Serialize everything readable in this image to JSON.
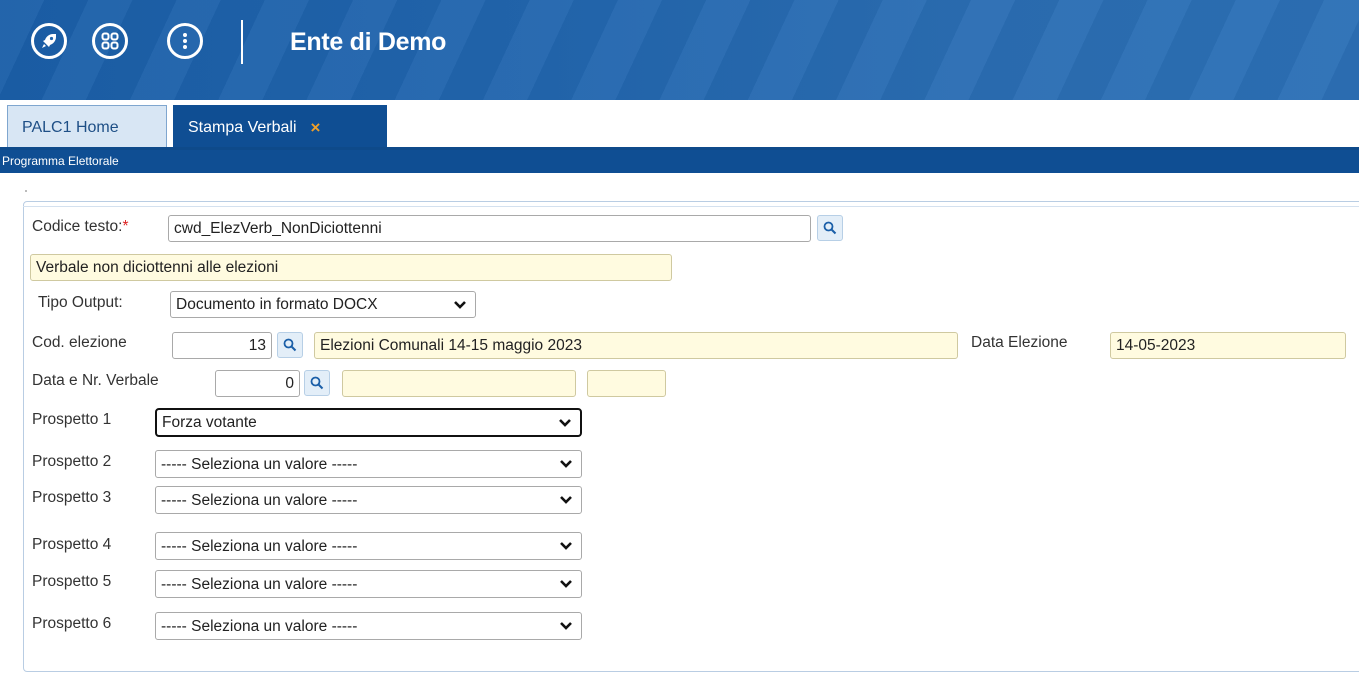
{
  "header": {
    "title": "Ente di Demo",
    "icons": [
      "rocket-icon",
      "apps-grid-icon",
      "more-vertical-icon"
    ]
  },
  "tabs": [
    {
      "label": "PALC1 Home",
      "active": false
    },
    {
      "label": "Stampa Verbali",
      "active": true,
      "close": "×"
    }
  ],
  "subbar": {
    "label": "Programma Elettorale"
  },
  "form": {
    "codice_testo": {
      "label": "Codice testo:",
      "required_mark": "*",
      "value": "cwd_ElezVerb_NonDiciottenni"
    },
    "descrizione": {
      "value": "Verbale non diciottenni alle elezioni"
    },
    "tipo_output": {
      "label": "Tipo Output:",
      "value": "Documento in formato DOCX"
    },
    "cod_elezione": {
      "label": "Cod. elezione",
      "value": "13",
      "description": "Elezioni Comunali 14-15 maggio 2023"
    },
    "data_elezione": {
      "label": "Data Elezione",
      "value": "14-05-2023"
    },
    "data_nr_verbale": {
      "label": "Data e Nr. Verbale",
      "value": "0",
      "date": "",
      "number": ""
    },
    "prospetti": [
      {
        "label": "Prospetto 1",
        "value": "Forza votante"
      },
      {
        "label": "Prospetto 2",
        "value": "----- Seleziona un valore -----"
      },
      {
        "label": "Prospetto 3",
        "value": "----- Seleziona un valore -----"
      },
      {
        "label": "Prospetto 4",
        "value": "----- Seleziona un valore -----"
      },
      {
        "label": "Prospetto 5",
        "value": "----- Seleziona un valore -----"
      },
      {
        "label": "Prospetto 6",
        "value": "----- Seleziona un valore -----"
      }
    ]
  },
  "colors": {
    "header_blue": "#2266ae",
    "tab_active": "#0f4e93",
    "readonly_bg": "#fffbe0",
    "required": "#dd2222",
    "close_icon": "#f0a028"
  }
}
